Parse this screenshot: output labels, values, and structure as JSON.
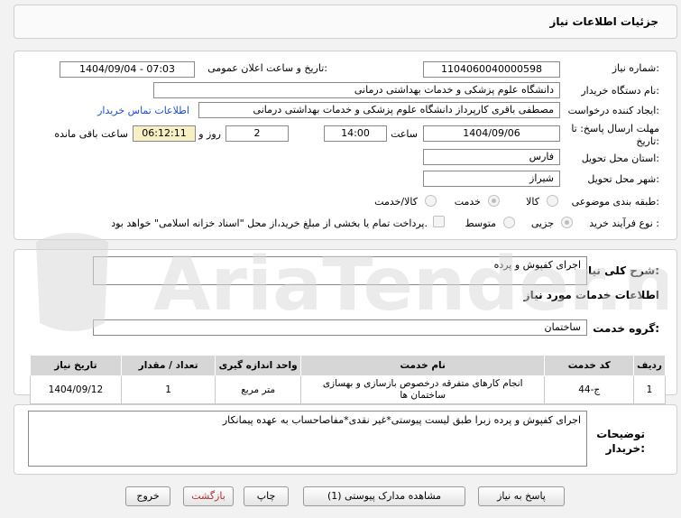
{
  "header": {
    "title": "جزئیات اطلاعات نیاز"
  },
  "form": {
    "need_number": {
      "label": "شماره نیاز:",
      "value": "1104060040000598"
    },
    "announce_datetime": {
      "label": "تاریخ و ساعت اعلان عمومی:",
      "value": "1404/09/04 - 07:03"
    },
    "buyer_org": {
      "label": "نام دستگاه خریدار:",
      "value": "دانشگاه علوم پزشکی و خدمات بهداشتی درمانی"
    },
    "requester": {
      "label": "ایجاد کننده درخواست:",
      "value": "مصطفی باقری کارپرداز دانشگاه علوم پزشکی و خدمات بهداشتی درمانی",
      "contact_link": "اطلاعات تماس خریدار"
    },
    "deadline": {
      "label_line1": "مهلت ارسال پاسخ: تا",
      "label_line2": "تاریخ:",
      "date": "1404/09/06",
      "time_label": "ساعت",
      "time": "14:00",
      "days": "2",
      "days_label": "روز و",
      "remaining": "06:12:11",
      "remaining_label": "ساعت باقی مانده"
    },
    "province": {
      "label": "استان محل تحویل:",
      "value": "فارس"
    },
    "city": {
      "label": "شهر محل تحویل:",
      "value": "شیراز"
    },
    "category": {
      "label": "طبقه بندی موضوعی:",
      "options": [
        "کالا",
        "خدمت",
        "کالا/خدمت"
      ],
      "selected": "خدمت"
    },
    "purchase_type": {
      "label": "نوع فرآیند خرید :",
      "options": [
        "جزیی",
        "متوسط"
      ],
      "selected": "جزیی",
      "payment_note": "پرداخت تمام یا بخشی از مبلغ خرید،از محل \"اسناد خزانه اسلامی\" خواهد بود."
    }
  },
  "description": {
    "label": "شرح کلی نیاز:",
    "value": "اجرای کفپوش و پرده"
  },
  "services_section": {
    "title": "اطلاعات خدمات مورد نیاز"
  },
  "service_group": {
    "label": "گروه خدمت:",
    "value": "ساختمان"
  },
  "table": {
    "headers": [
      "ردیف",
      "کد خدمت",
      "نام خدمت",
      "واحد اندازه گیری",
      "تعداد / مقدار",
      "تاریخ نیاز"
    ],
    "rows": [
      [
        "1",
        "ج-44",
        "انجام کارهای متفرقه درخصوص بازسازی و بهسازی ساختمان ها",
        "متر مربع",
        "1",
        "1404/09/12"
      ]
    ]
  },
  "buyer_notes": {
    "label_line1": "توضیحات",
    "label_line2": "خریدار:",
    "value": "اجرای کفپوش و پرده زبرا طبق لیست پیوستی*غیر نقدی*مفاصاحساب به عهده پیمانکار"
  },
  "buttons": {
    "reply": "پاسخ به نیاز",
    "view_docs": "مشاهده مدارک پیوستی (1)",
    "print": "چاپ",
    "back": "بازگشت",
    "exit": "خروج"
  },
  "watermark": {
    "text": "AriaTender.net"
  },
  "colors": {
    "accent_link": "#1a4fd6",
    "remaining_bg": "#f7f0c4",
    "header_bg": "#fafafa"
  }
}
